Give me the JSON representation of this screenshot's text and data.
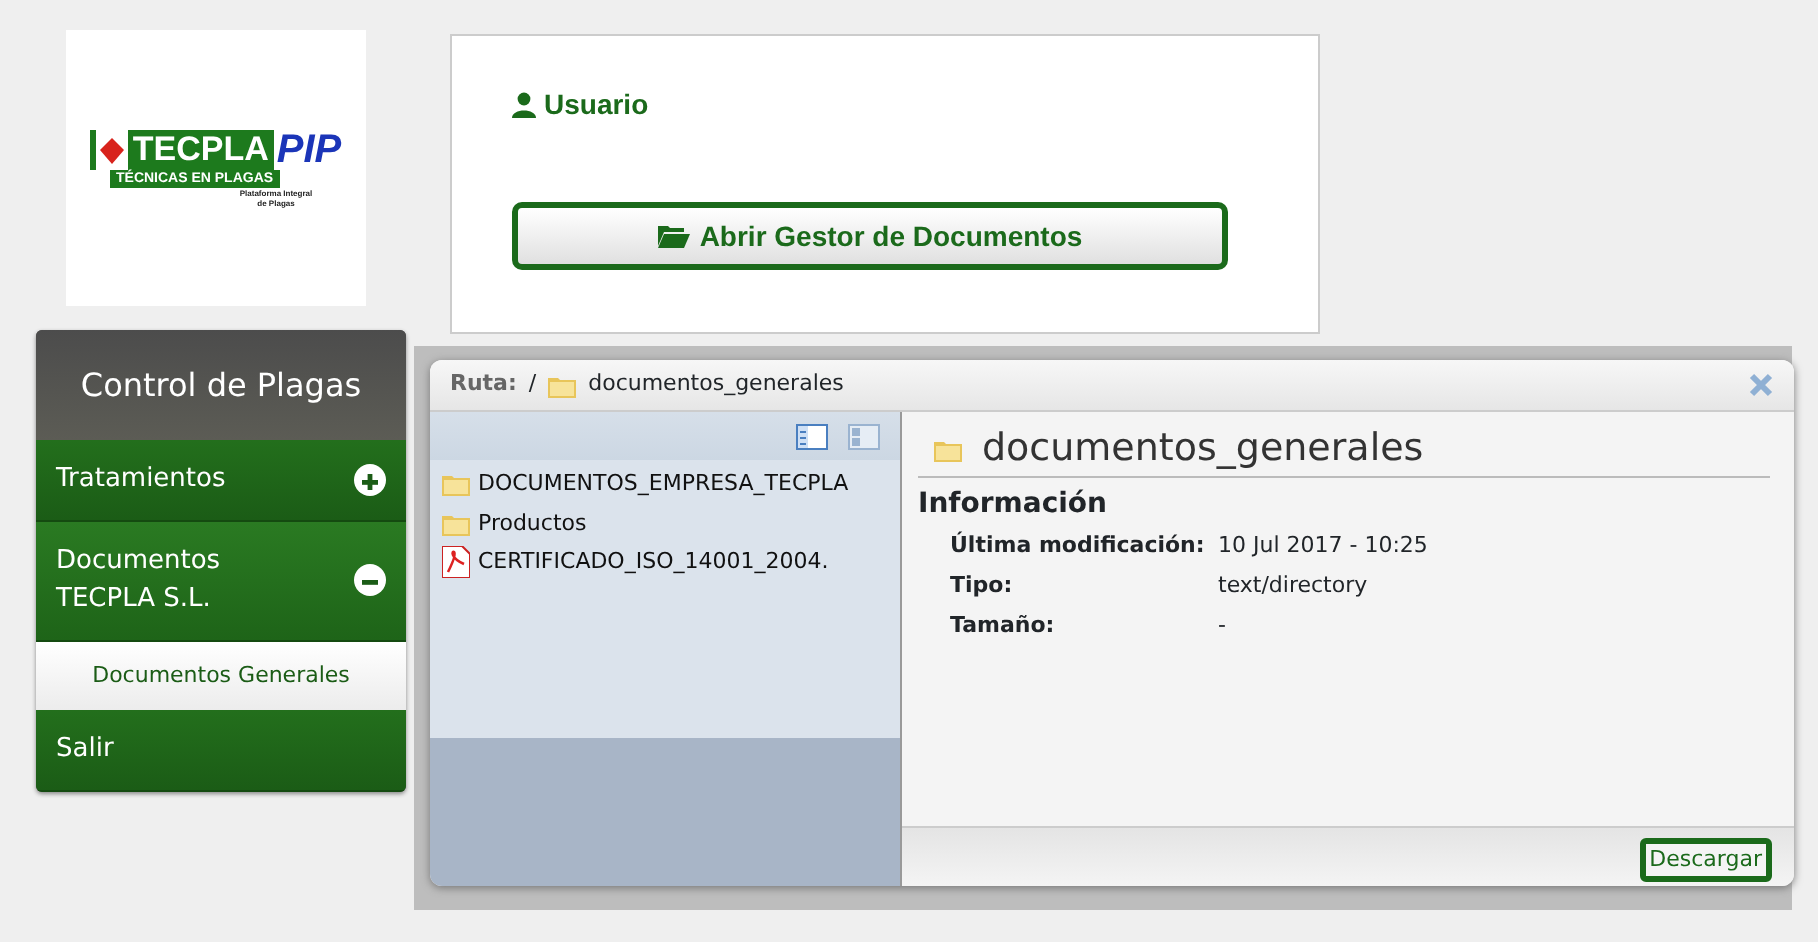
{
  "logo": {
    "brand": "TECPLA",
    "suffix": "PIP",
    "tagline": "TÉCNICAS EN PLAGAS",
    "subtitle": "Plataforma Integral de Plagas"
  },
  "user_card": {
    "user_label": "Usuario",
    "open_button": "Abrir Gestor de Documentos"
  },
  "sidebar": {
    "title": "Control de Plagas",
    "items": [
      {
        "label": "Tratamientos",
        "expanded": false
      },
      {
        "label": "Documentos TECPLA S.L.",
        "expanded": true,
        "children": [
          {
            "label": "Documentos Generales",
            "selected": true
          }
        ]
      },
      {
        "label": "Salir"
      }
    ]
  },
  "file_manager": {
    "path_label": "Ruta:",
    "path_separator": "/",
    "path_folder": "documentos_generales",
    "files": [
      {
        "kind": "folder",
        "name": "DOCUMENTOS_EMPRESA_TECPLA"
      },
      {
        "kind": "folder",
        "name": "Productos"
      },
      {
        "kind": "pdf",
        "name": "CERTIFICADO_ISO_14001_2004."
      }
    ],
    "details_title": "documentos_generales",
    "info_heading": "Información",
    "info": [
      {
        "label": "Última modificación:",
        "value": "10 Jul 2017 - 10:25"
      },
      {
        "label": "Tipo:",
        "value": "text/directory"
      },
      {
        "label": "Tamaño:",
        "value": "-"
      }
    ],
    "download_button": "Descargar"
  }
}
